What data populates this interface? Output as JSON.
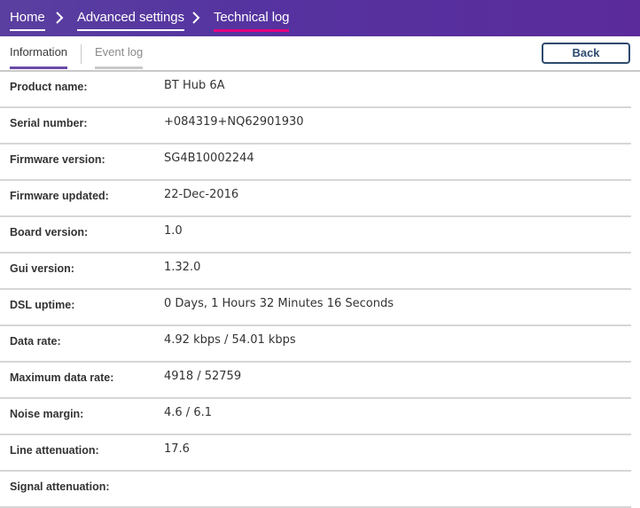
{
  "breadcrumb": {
    "home": "Home",
    "advanced": "Advanced settings",
    "current": "Technical log"
  },
  "tabs": {
    "information": "Information",
    "event_log": "Event log"
  },
  "back_label": "Back",
  "rows": [
    {
      "label": "Product name:",
      "value": "BT Hub 6A"
    },
    {
      "label": "Serial number:",
      "value": "+084319+NQ62901930"
    },
    {
      "label": "Firmware version:",
      "value": "SG4B10002244"
    },
    {
      "label": "Firmware updated:",
      "value": "22-Dec-2016"
    },
    {
      "label": "Board version:",
      "value": "1.0"
    },
    {
      "label": "Gui version:",
      "value": "1.32.0"
    },
    {
      "label": "DSL uptime:",
      "value": "0 Days, 1 Hours 32 Minutes 16 Seconds"
    },
    {
      "label": "Data rate:",
      "value": "4.92 kbps / 54.01 kbps"
    },
    {
      "label": "Maximum data rate:",
      "value": "4918 / 52759"
    },
    {
      "label": "Noise margin:",
      "value": "4.6 / 6.1"
    },
    {
      "label": "Line attenuation:",
      "value": "17.6"
    },
    {
      "label": "Signal attenuation:",
      "value": ""
    }
  ]
}
